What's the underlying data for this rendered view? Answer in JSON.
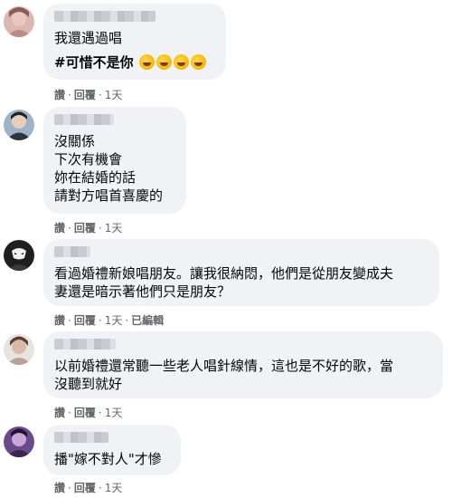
{
  "comments": [
    {
      "lines": [
        "我還遇過唱",
        "#可惜不是你"
      ],
      "emoji_count": 4,
      "actions": {
        "like": "讚",
        "reply": "回覆",
        "time": "1天"
      }
    },
    {
      "lines": [
        "沒關係",
        "下次有機會",
        "妳在結婚的話",
        "請對方唱首喜慶的"
      ],
      "actions": {
        "like": "讚",
        "reply": "回覆",
        "time": "1天"
      }
    },
    {
      "lines": [
        "看過婚禮新娘唱朋友。讓我很納悶，他們是從朋友變成夫",
        "妻還是暗示著他們只是朋友？"
      ],
      "actions": {
        "like": "讚",
        "reply": "回覆",
        "time": "1天",
        "edited": "已編輯"
      }
    },
    {
      "lines": [
        "以前婚禮還常聽一些老人唱針線情，這也是不好的歌，當",
        "沒聽到就好"
      ],
      "actions": {
        "like": "讚",
        "reply": "回覆",
        "time": "1天"
      }
    },
    {
      "lines": [
        "播\"嫁不對人\"才慘"
      ],
      "actions": {
        "like": "讚",
        "reply": "回覆",
        "time": "1天"
      }
    }
  ],
  "separator": "·",
  "colors": {
    "bubble": "#f0f2f5",
    "meta": "#65676b",
    "text": "#050505"
  }
}
